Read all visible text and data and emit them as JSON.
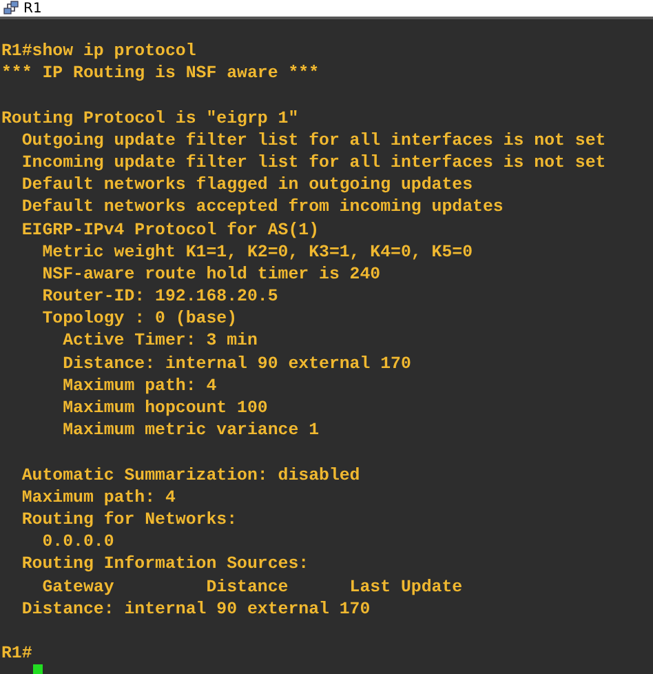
{
  "window": {
    "title": "R1"
  },
  "terminal": {
    "blocks": [
      [
        "R1#show ip protocol",
        "*** IP Routing is NSF aware ***"
      ],
      [
        "Routing Protocol is \"eigrp 1\"",
        "  Outgoing update filter list for all interfaces is not set",
        "  Incoming update filter list for all interfaces is not set",
        "  Default networks flagged in outgoing updates",
        "  Default networks accepted from incoming updates",
        "  EIGRP-IPv4 Protocol for AS(1)",
        "    Metric weight K1=1, K2=0, K3=1, K4=0, K5=0",
        "    NSF-aware route hold timer is 240",
        "    Router-ID: 192.168.20.5",
        "    Topology : 0 (base)",
        "      Active Timer: 3 min",
        "      Distance: internal 90 external 170",
        "      Maximum path: 4",
        "      Maximum hopcount 100",
        "      Maximum metric variance 1"
      ],
      [
        "  Automatic Summarization: disabled",
        "  Maximum path: 4",
        "  Routing for Networks:",
        "    0.0.0.0",
        "  Routing Information Sources:",
        "    Gateway         Distance      Last Update",
        "  Distance: internal 90 external 170"
      ],
      [
        "R1#"
      ]
    ]
  }
}
